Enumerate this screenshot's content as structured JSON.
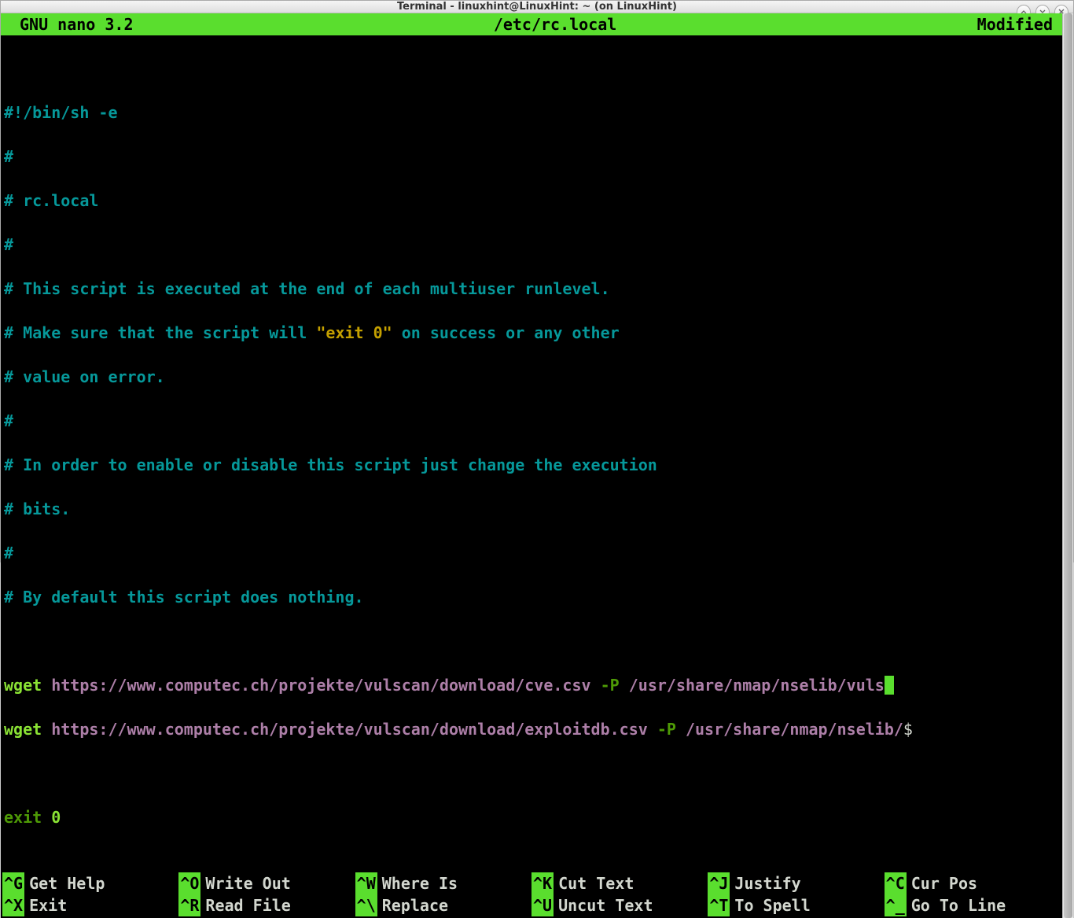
{
  "window": {
    "title": "Terminal - linuxhint@LinuxHint: ~ (on LinuxHint)"
  },
  "nano": {
    "header": {
      "left": "GNU nano 3.2",
      "center": "/etc/rc.local",
      "right": "Modified"
    },
    "body": {
      "l1": "#!/bin/sh -e",
      "l2": "#",
      "l3": "# rc.local",
      "l4": "#",
      "l5": "# This script is executed at the end of each multiuser runlevel.",
      "l6a": "# Make sure that the script will ",
      "l6b": "\"exit 0\"",
      "l6c": " on success or any other",
      "l7": "# value on error.",
      "l8": "#",
      "l9": "# In order to enable or disable this script just change the execution",
      "l10": "# bits.",
      "l11": "#",
      "l12": "# By default this script does nothing.",
      "w1a": "wget ",
      "w1b": "https://www.computec.ch/projekte/vulscan/download/cve.csv ",
      "w1c": "-P ",
      "w1d": "/usr/share/nmap/nselib/vuls",
      "w2a": "wget ",
      "w2b": "https://www.computec.ch/projekte/vulscan/download/exploitdb.csv ",
      "w2c": "-P ",
      "w2d": "/usr/share/nmap/nselib/",
      "w2e": "$",
      "exit_a": "exit",
      "exit_b": " 0"
    },
    "shortcuts": [
      {
        "key": "^G",
        "label": "Get Help"
      },
      {
        "key": "^O",
        "label": "Write Out"
      },
      {
        "key": "^W",
        "label": "Where Is"
      },
      {
        "key": "^K",
        "label": "Cut Text"
      },
      {
        "key": "^J",
        "label": "Justify"
      },
      {
        "key": "^C",
        "label": "Cur Pos"
      },
      {
        "key": "^X",
        "label": "Exit"
      },
      {
        "key": "^R",
        "label": "Read File"
      },
      {
        "key": "^\\",
        "label": "Replace"
      },
      {
        "key": "^U",
        "label": "Uncut Text"
      },
      {
        "key": "^T",
        "label": "To Spell"
      },
      {
        "key": "^_",
        "label": "Go To Line"
      }
    ]
  }
}
